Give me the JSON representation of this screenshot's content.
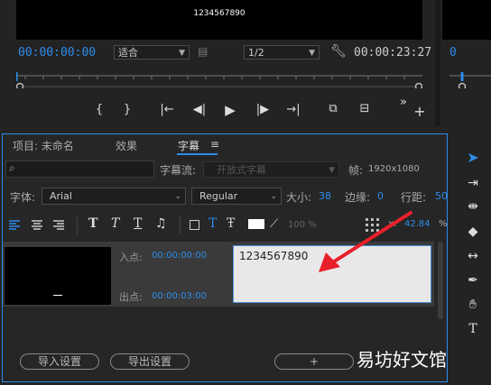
{
  "monitor": {
    "caption_preview": "1234567890",
    "timecode_current": "00:00:00:00",
    "fit_label": "适合",
    "resolution_label": "1/2",
    "timecode_duration": "00:00:23:27"
  },
  "transport": {
    "buttons": [
      "{",
      "}",
      "|←",
      "◀|",
      "▶",
      "|▶",
      "→|",
      "⧉",
      "⊟",
      "»",
      "+"
    ]
  },
  "panel": {
    "tabs": [
      {
        "label": "项目: 未命名",
        "active": false
      },
      {
        "label": "效果",
        "active": false
      },
      {
        "label": "字幕",
        "active": true
      }
    ],
    "stream_label": "字幕流:",
    "stream_value": "开放式字幕",
    "frame_label": "帧:",
    "frame_value": "1920x1080",
    "font_label": "字体:",
    "font_value": "Arial",
    "style_value": "Regular",
    "size_label": "大小:",
    "size_value": "38",
    "edge_label": "边缘:",
    "edge_value": "0",
    "line_label": "行距:",
    "line_value": "50",
    "opacity_value": "100",
    "opacity_unit": "%",
    "x_label": "x:",
    "x_value": "42.84",
    "x_unit": "%",
    "text_tools": [
      "T",
      "T",
      "T",
      "♫"
    ],
    "caption": {
      "in_label": "入点:",
      "in_value": "00:00:00:00",
      "out_label": "出点:",
      "out_value": "00:00:03:00",
      "text": "1234567890"
    },
    "import_button": "导入设置",
    "export_button": "导出设置",
    "add_button": "+"
  },
  "watermark": "易坊好文馆",
  "colors": {
    "accent": "#2d8ceb",
    "arrow": "#e8202a",
    "background": "#232323"
  }
}
